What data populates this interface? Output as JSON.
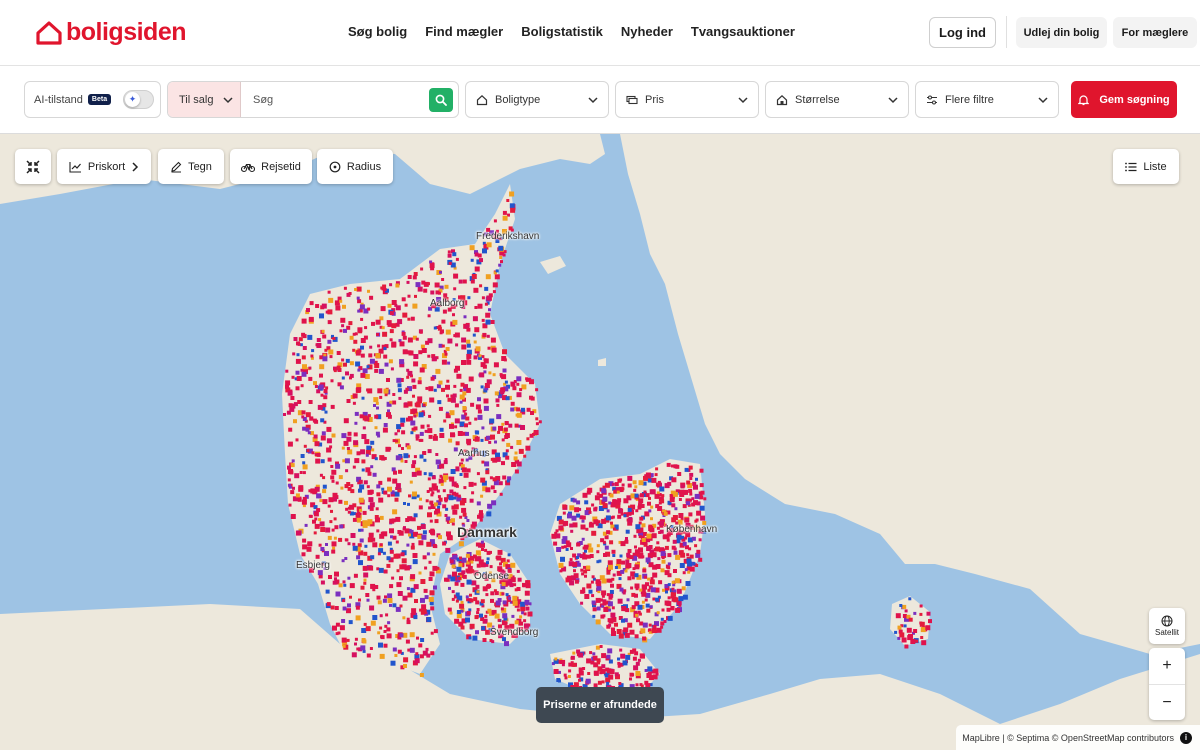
{
  "brand": {
    "name": "boligsiden",
    "color": "#e0152d"
  },
  "nav": {
    "items": [
      "Søg bolig",
      "Find mægler",
      "Boligstatistik",
      "Nyheder",
      "Tvangsauktioner"
    ],
    "login": "Log ind",
    "rent_out": "Udlej din bolig",
    "for_agents": "For mæglere"
  },
  "filters": {
    "ai_label": "AI-tilstand",
    "ai_badge": "Beta",
    "sale_mode": "Til salg",
    "search_placeholder": "Søg",
    "property_type": "Boligtype",
    "price": "Pris",
    "size": "Størrelse",
    "more_filters": "Flere filtre",
    "save_search": "Gem søgning"
  },
  "map": {
    "controls": {
      "collapse_icon": "collapse-icon",
      "price_map": "Priskort",
      "draw": "Tegn",
      "travel_time": "Rejsetid",
      "radius": "Radius",
      "list": "Liste",
      "satellite": "Satellit",
      "zoom_in": "+",
      "zoom_out": "−"
    },
    "labels": {
      "frederikshavn": "Frederikshavn",
      "aalborg": "Aalborg",
      "aarhus": "Aarhus",
      "denmark": "Danmark",
      "copenhagen": "København",
      "esbjerg": "Esbjerg",
      "odense": "Odense",
      "svendborg": "Svendborg"
    },
    "notice": "Priserne er afrundede",
    "attribution": "MapLibre | © Septima © OpenStreetMap contributors",
    "colors": {
      "water": "#9ec3e4",
      "land": "#ede8dc",
      "marker": "#e0134b"
    }
  }
}
